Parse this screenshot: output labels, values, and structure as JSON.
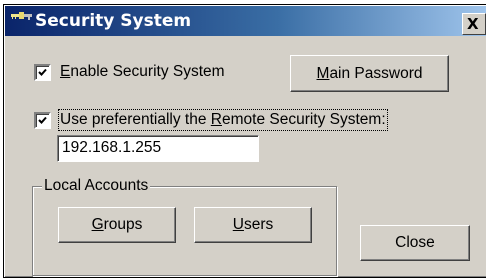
{
  "window": {
    "title": "Security System",
    "close_glyph": "X",
    "title_icon": "keys-icon"
  },
  "enable_security": {
    "checked": true,
    "label_accel": "E",
    "label_rest": "nable Security System"
  },
  "main_password_button": {
    "label_accel": "M",
    "label_rest": "ain Password"
  },
  "remote_security": {
    "checked": true,
    "label_before": "Use preferentially the ",
    "label_accel": "R",
    "label_after": "emote Security System:",
    "address_value": "192.168.1.255"
  },
  "local_accounts": {
    "legend": "Local Accounts",
    "groups_button": {
      "label_accel": "G",
      "label_rest": "roups"
    },
    "users_button": {
      "label_accel": "U",
      "label_rest": "sers"
    }
  },
  "close_button": {
    "label": "Close"
  },
  "colors": {
    "face": "#d4d0c8",
    "titlebar_start": "#0a246a",
    "titlebar_end": "#a6caf0"
  }
}
